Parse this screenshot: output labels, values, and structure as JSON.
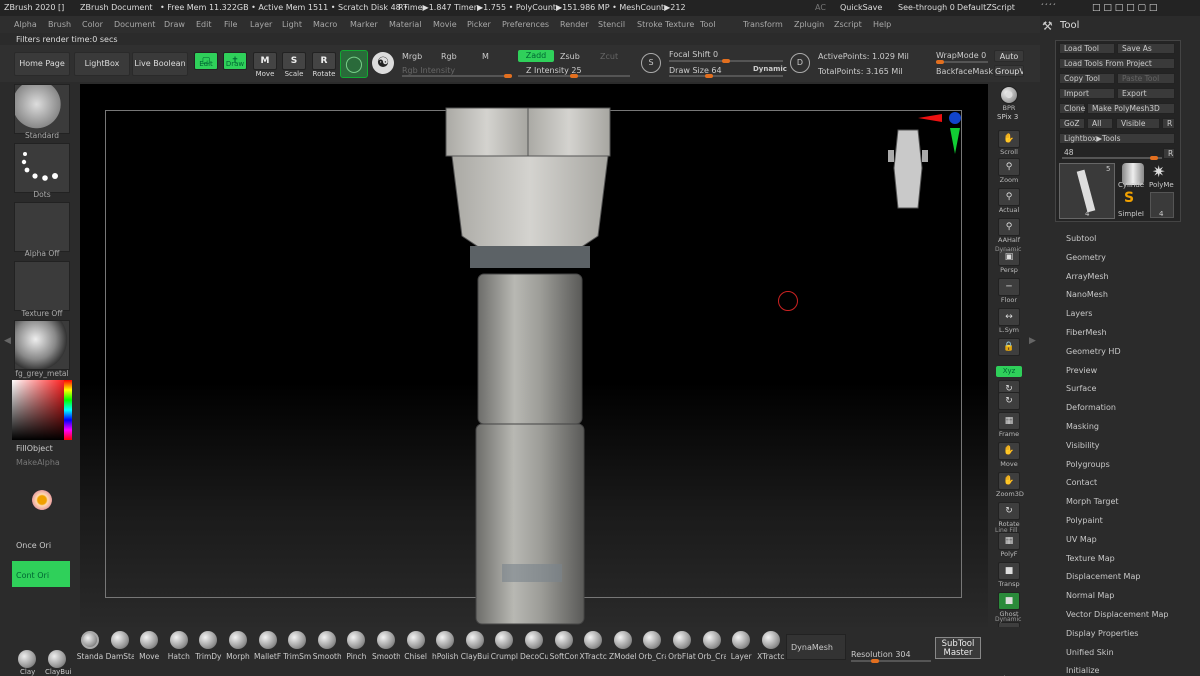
{
  "titlebar": {
    "app": "ZBrush 2020 []",
    "doc": "ZBrush Document",
    "free_mem": "• Free Mem 11.322GB • Active Mem 1511 • Scratch Disk 48 •",
    "rtime": "RTime▶1.847 Timer▶1.755 • PolyCount▶151.986 MP • MeshCount▶212",
    "ac": "AC",
    "quicksave": "QuickSave",
    "see_through": "See-through  0",
    "defaultzscript": "DefaultZScript",
    "ui_glyphs": "´´´´"
  },
  "menu": [
    "Alpha",
    "Brush",
    "Color",
    "Document",
    "Draw",
    "Edit",
    "File",
    "Layer",
    "Light",
    "Macro",
    "Marker",
    "Material",
    "Movie",
    "Picker",
    "Preferences",
    "Render",
    "Stencil",
    "Stroke",
    "Texture",
    "Tool",
    "Transform",
    "Zplugin",
    "Zscript",
    "Help"
  ],
  "info": "Filters render time:0 secs",
  "shelf": {
    "home": "Home Page",
    "lightbox": "LightBox",
    "liveboolean": "Live Boolean",
    "edit": "Edit",
    "draw": "Draw",
    "move": "Move",
    "scale": "Scale",
    "rotate": "Rotate",
    "mrgb": "Mrgb",
    "rgb": "Rgb",
    "m": "M",
    "rgb_intensity": "Rgb Intensity",
    "zadd": "Zadd",
    "zsub": "Zsub",
    "zcut": "Zcut",
    "z_intensity": "Z Intensity 25",
    "focal_shift": "Focal Shift  0",
    "draw_size": "Draw Size  64",
    "dynamic": "Dynamic",
    "active_points": "ActivePoints: 1.029 Mil",
    "total_points": "TotalPoints: 3.165 Mil",
    "wrapmode": "WrapMode  0",
    "backfacemask": "BackfaceMask",
    "autogr": "Auto Gr",
    "groupv": "GroupV",
    "s_label": "S",
    "d_label": "D"
  },
  "left": {
    "standard": "Standard",
    "dots": "Dots",
    "alpha_off": "Alpha Off",
    "texture_off": "Texture Off",
    "material": "fg_grey_metal",
    "fillobject": "FillObject",
    "makealpha": "MakeAlpha",
    "once_ori": "Once Ori",
    "cont_ori": "Cont Ori"
  },
  "rightshelf": [
    "BPR",
    "SPix 3",
    "Scroll",
    "Zoom",
    "Actual",
    "AAHalf",
    "Persp",
    "Floor",
    "L.Sym",
    "",
    "Xyz",
    "",
    "",
    "Frame",
    "Move",
    "Zoom3D",
    "Rotate",
    "PolyF",
    "Transp",
    "Ghost",
    "Solo",
    "Xpose"
  ],
  "rightshelf_dynamic": "Dynamic",
  "rightshelf_line_fill": "Line Fill",
  "tool": {
    "title": "Tool",
    "load_tool": "Load Tool",
    "save_as": "Save As",
    "load_from_project": "Load Tools From Project",
    "copy_tool": "Copy Tool",
    "paste_tool": "Paste Tool",
    "import": "Import",
    "export": "Export",
    "clone": "Clone",
    "make_polymesh": "Make PolyMesh3D",
    "goz": "GoZ",
    "all": "All",
    "visible": "Visible",
    "r": "R",
    "lightbox_tools": "Lightbox▶Tools",
    "slider_val": "48",
    "thumb_count": "5",
    "thumb_sub": "4",
    "cylinder": "Cylinde",
    "polymesh": "PolyMe",
    "simple": "SimpleI",
    "simple_count": "4"
  },
  "subpalettes": [
    "Subtool",
    "Geometry",
    "ArrayMesh",
    "NanoMesh",
    "Layers",
    "FiberMesh",
    "Geometry HD",
    "Preview",
    "Surface",
    "Deformation",
    "Masking",
    "Visibility",
    "Polygroups",
    "Contact",
    "Morph Target",
    "Polypaint",
    "UV Map",
    "Texture Map",
    "Displacement Map",
    "Normal Map",
    "Vector Displacement Map",
    "Display Properties",
    "Unified Skin",
    "Initialize"
  ],
  "brushes": [
    "Standa",
    "DamSta",
    "Move",
    "Hatch",
    "TrimDy",
    "Morph",
    "MalletF",
    "TrimSm",
    "Smooth",
    "Pinch",
    "Smooth",
    "Chisel",
    "hPolish",
    "ClayBui",
    "Crumpl",
    "DecoCu",
    "SoftCon",
    "XTractc",
    "ZModel",
    "Orb_Cra",
    "OrbFlat",
    "Orb_Cra",
    "Layer",
    "XTractc"
  ],
  "bottom": {
    "dynamesh": "DynaMesh",
    "resolution": "Resolution 304",
    "subtool_master": "SubTool\nMaster",
    "clay": "Clay",
    "claybui": "ClayBui"
  },
  "colors": {
    "accent_green": "#2fd05a",
    "slider_orange": "#e26f1f"
  }
}
